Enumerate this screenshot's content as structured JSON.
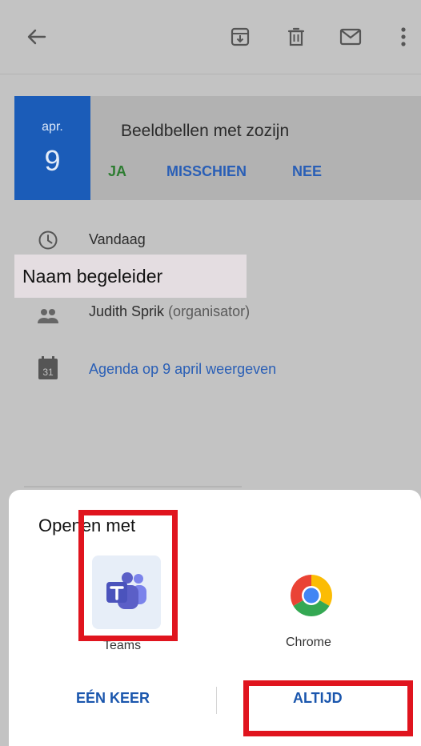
{
  "toolbar": {
    "back_icon": "arrow-left-icon",
    "archive_icon": "archive-icon",
    "delete_icon": "trash-icon",
    "mail_icon": "mail-icon",
    "more_icon": "more-vert-icon"
  },
  "event": {
    "month": "apr.",
    "day": "9",
    "title": "Beeldbellen met zozijn",
    "rsvp": {
      "yes": "JA",
      "maybe": "MISSCHIEN",
      "no": "NEE"
    }
  },
  "details": {
    "time": "Vandaag",
    "organizer_name": "Judith Sprik",
    "organizer_role": "(organisator)",
    "calendar_day": "31",
    "calendar_link": "Agenda op 9 april weergeven"
  },
  "overlay_label": "Naam begeleider",
  "chooser": {
    "title": "Openen met",
    "apps": [
      {
        "label": "Teams"
      },
      {
        "label": "Chrome"
      }
    ],
    "once_button": "EÉN KEER",
    "always_button": "ALTIJD"
  },
  "colors": {
    "date_block": "#1b5cb8",
    "rsvp_yes": "#2e7d32",
    "link": "#2a5fb6",
    "highlight": "#e0141e"
  }
}
